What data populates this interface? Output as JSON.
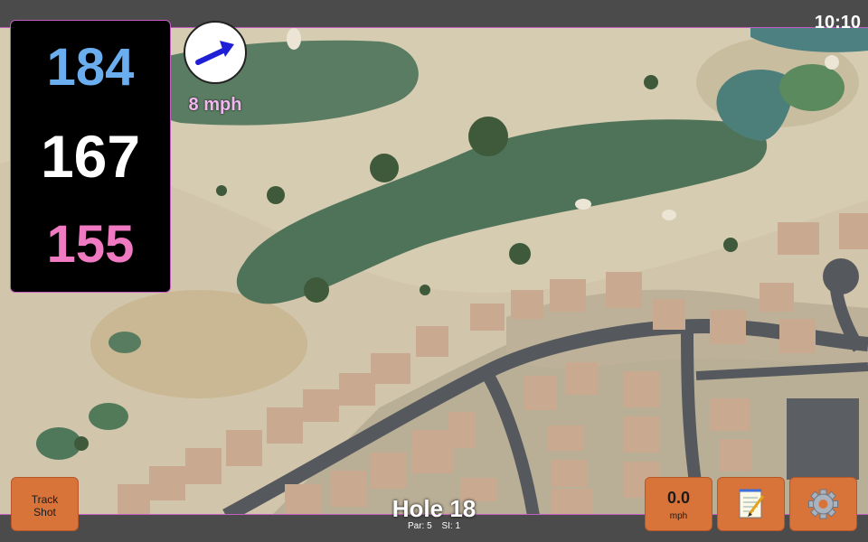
{
  "status": {
    "time": "10:10"
  },
  "distances": {
    "back": "184",
    "middle": "167",
    "front": "155"
  },
  "wind": {
    "speed": "8 mph",
    "icon": "wind-arrow-icon"
  },
  "hole": {
    "title": "Hole 18",
    "par": "Par: 5",
    "stroke_index": "SI: 1"
  },
  "buttons": {
    "track_shot_line1": "Track",
    "track_shot_line2": "Shot",
    "speed_value": "0.0",
    "speed_unit": "mph",
    "notes_icon": "notepad-icon",
    "settings_icon": "gear-icon"
  },
  "colors": {
    "back": "#6aaef0",
    "middle": "#ffffff",
    "front": "#f07ac2",
    "button": "#d8733a",
    "accent_border": "#c45cc4"
  }
}
